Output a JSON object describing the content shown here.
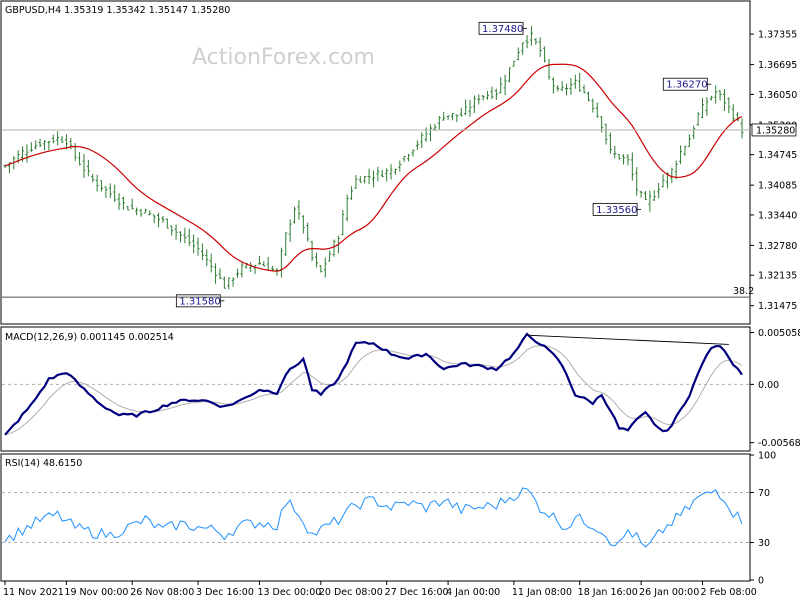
{
  "chart_data": [
    {
      "type": "bar",
      "title": "GBPUSD,H4  1.35319 1.35342 1.35147 1.35280",
      "watermark": "ActionForex.com",
      "ylim": [
        1.311,
        1.3805
      ],
      "y_ticks": [
        "1.37355",
        "1.36695",
        "1.36050",
        "1.35390",
        "1.34745",
        "1.34085",
        "1.33440",
        "1.32780",
        "1.32135",
        "1.31475"
      ],
      "y_tick_values": [
        1.37355,
        1.36695,
        1.3605,
        1.3539,
        1.34745,
        1.34085,
        1.3344,
        1.3278,
        1.32135,
        1.31475
      ],
      "current_price": "1.35280",
      "current_price_value": 1.3528,
      "fib_label": "38.2",
      "fib_level": 1.3166,
      "moving_average_color": "#cc0000",
      "bar_color": "#2e7d32",
      "callouts": [
        {
          "label": "1.37480",
          "value": 1.3748,
          "bar": 119
        },
        {
          "label": "1.36270",
          "value": 1.3627,
          "bar": 161
        },
        {
          "label": "1.33560",
          "value": 1.3356,
          "bar": 145
        },
        {
          "label": "1.31580",
          "value": 1.3158,
          "bar": 50
        }
      ],
      "price_anchors": [
        [
          0,
          1.345
        ],
        [
          4,
          1.348
        ],
        [
          8,
          1.35
        ],
        [
          12,
          1.351
        ],
        [
          14,
          1.3505
        ],
        [
          16,
          1.347
        ],
        [
          20,
          1.342
        ],
        [
          24,
          1.339
        ],
        [
          28,
          1.336
        ],
        [
          32,
          1.335
        ],
        [
          36,
          1.333
        ],
        [
          40,
          1.33
        ],
        [
          44,
          1.327
        ],
        [
          48,
          1.322
        ],
        [
          50,
          1.319
        ],
        [
          54,
          1.323
        ],
        [
          58,
          1.324
        ],
        [
          62,
          1.322
        ],
        [
          64,
          1.33
        ],
        [
          66,
          1.336
        ],
        [
          68,
          1.332
        ],
        [
          70,
          1.325
        ],
        [
          72,
          1.322
        ],
        [
          74,
          1.326
        ],
        [
          76,
          1.33
        ],
        [
          78,
          1.338
        ],
        [
          80,
          1.342
        ],
        [
          84,
          1.343
        ],
        [
          88,
          1.344
        ],
        [
          92,
          1.348
        ],
        [
          96,
          1.352
        ],
        [
          100,
          1.356
        ],
        [
          104,
          1.356
        ],
        [
          108,
          1.36
        ],
        [
          112,
          1.361
        ],
        [
          114,
          1.364
        ],
        [
          116,
          1.368
        ],
        [
          118,
          1.372
        ],
        [
          120,
          1.373
        ],
        [
          122,
          1.37
        ],
        [
          124,
          1.364
        ],
        [
          126,
          1.361
        ],
        [
          128,
          1.362
        ],
        [
          130,
          1.363
        ],
        [
          132,
          1.361
        ],
        [
          134,
          1.358
        ],
        [
          136,
          1.354
        ],
        [
          138,
          1.348
        ],
        [
          140,
          1.347
        ],
        [
          142,
          1.346
        ],
        [
          144,
          1.34
        ],
        [
          146,
          1.337
        ],
        [
          148,
          1.339
        ],
        [
          150,
          1.342
        ],
        [
          152,
          1.344
        ],
        [
          154,
          1.348
        ],
        [
          156,
          1.351
        ],
        [
          158,
          1.356
        ],
        [
          160,
          1.359
        ],
        [
          162,
          1.361
        ],
        [
          164,
          1.359
        ],
        [
          166,
          1.356
        ],
        [
          168,
          1.3528
        ]
      ]
    },
    {
      "type": "line",
      "title": "MACD(12,26,9) 0.001145 0.002514",
      "ylim": [
        -0.0064,
        0.0055
      ],
      "y_ticks": [
        "0.005058",
        "0.00",
        "-0.005682"
      ],
      "y_tick_values": [
        0.005058,
        0.0,
        -0.005682
      ],
      "series": [
        {
          "color": "#00007f"
        },
        {
          "color": "#b0b0b0"
        }
      ],
      "macd_anchors": [
        [
          0,
          -0.005
        ],
        [
          6,
          -0.002
        ],
        [
          10,
          0.0005
        ],
        [
          14,
          0.0012
        ],
        [
          18,
          -0.0005
        ],
        [
          22,
          -0.002
        ],
        [
          26,
          -0.003
        ],
        [
          30,
          -0.003
        ],
        [
          34,
          -0.0025
        ],
        [
          38,
          -0.0018
        ],
        [
          42,
          -0.0015
        ],
        [
          46,
          -0.0016
        ],
        [
          50,
          -0.0022
        ],
        [
          54,
          -0.0015
        ],
        [
          58,
          -0.0005
        ],
        [
          62,
          -0.0008
        ],
        [
          64,
          0.001
        ],
        [
          68,
          0.0025
        ],
        [
          70,
          -0.0005
        ],
        [
          72,
          -0.001
        ],
        [
          76,
          0.0005
        ],
        [
          80,
          0.004
        ],
        [
          84,
          0.004
        ],
        [
          88,
          0.003
        ],
        [
          92,
          0.0025
        ],
        [
          96,
          0.003
        ],
        [
          100,
          0.0015
        ],
        [
          104,
          0.002
        ],
        [
          108,
          0.0018
        ],
        [
          112,
          0.0015
        ],
        [
          116,
          0.003
        ],
        [
          119,
          0.0048
        ],
        [
          122,
          0.004
        ],
        [
          126,
          0.0025
        ],
        [
          128,
          0.001
        ],
        [
          130,
          -0.001
        ],
        [
          134,
          -0.0018
        ],
        [
          136,
          -0.001
        ],
        [
          138,
          -0.0025
        ],
        [
          140,
          -0.0043
        ],
        [
          142,
          -0.0045
        ],
        [
          144,
          -0.0035
        ],
        [
          146,
          -0.0028
        ],
        [
          148,
          -0.0038
        ],
        [
          150,
          -0.0047
        ],
        [
          152,
          -0.004
        ],
        [
          154,
          -0.0025
        ],
        [
          156,
          -0.001
        ],
        [
          158,
          0.001
        ],
        [
          160,
          0.003
        ],
        [
          162,
          0.0038
        ],
        [
          164,
          0.0034
        ],
        [
          166,
          0.002
        ],
        [
          168,
          0.0011
        ]
      ],
      "divergence_line": [
        [
          119,
          0.0048
        ],
        [
          165,
          0.0039
        ]
      ]
    },
    {
      "type": "line",
      "title": "RSI(14) 48.6150",
      "ylim": [
        0,
        100
      ],
      "y_ticks": [
        "100",
        "70",
        "30",
        "0"
      ],
      "y_tick_values": [
        100,
        70,
        30,
        0
      ],
      "levels": [
        70,
        30
      ],
      "series": [
        {
          "color": "#1e90ff"
        }
      ],
      "rsi_anchors": [
        [
          0,
          32
        ],
        [
          4,
          40
        ],
        [
          8,
          48
        ],
        [
          12,
          52
        ],
        [
          16,
          42
        ],
        [
          20,
          38
        ],
        [
          24,
          36
        ],
        [
          28,
          42
        ],
        [
          32,
          48
        ],
        [
          36,
          40
        ],
        [
          40,
          45
        ],
        [
          44,
          42
        ],
        [
          48,
          40
        ],
        [
          50,
          36
        ],
        [
          54,
          44
        ],
        [
          58,
          46
        ],
        [
          62,
          44
        ],
        [
          64,
          62
        ],
        [
          66,
          58
        ],
        [
          68,
          48
        ],
        [
          70,
          36
        ],
        [
          72,
          40
        ],
        [
          76,
          48
        ],
        [
          80,
          60
        ],
        [
          84,
          64
        ],
        [
          88,
          58
        ],
        [
          92,
          62
        ],
        [
          96,
          58
        ],
        [
          100,
          64
        ],
        [
          104,
          56
        ],
        [
          108,
          58
        ],
        [
          112,
          60
        ],
        [
          116,
          68
        ],
        [
          119,
          72
        ],
        [
          122,
          58
        ],
        [
          126,
          48
        ],
        [
          128,
          42
        ],
        [
          130,
          50
        ],
        [
          134,
          44
        ],
        [
          136,
          40
        ],
        [
          138,
          32
        ],
        [
          140,
          28
        ],
        [
          142,
          40
        ],
        [
          144,
          34
        ],
        [
          146,
          24
        ],
        [
          148,
          32
        ],
        [
          150,
          40
        ],
        [
          152,
          46
        ],
        [
          154,
          52
        ],
        [
          156,
          58
        ],
        [
          158,
          66
        ],
        [
          160,
          68
        ],
        [
          162,
          72
        ],
        [
          164,
          66
        ],
        [
          166,
          54
        ],
        [
          168,
          48
        ]
      ]
    }
  ],
  "x_axis": {
    "labels": [
      "11 Nov 2021",
      "19 Nov 00:00",
      "26 Nov 08:00",
      "3 Dec 16:00",
      "13 Dec 00:00",
      "20 Dec 08:00",
      "27 Dec 16:00",
      "4 Jan 00:00",
      "11 Jan 08:00",
      "18 Jan 16:00",
      "26 Jan 00:00",
      "2 Feb 08:00"
    ],
    "label_bars": [
      0,
      14,
      29,
      44,
      58,
      72,
      87,
      101,
      116,
      131,
      145,
      159
    ],
    "bar_count": 169
  }
}
